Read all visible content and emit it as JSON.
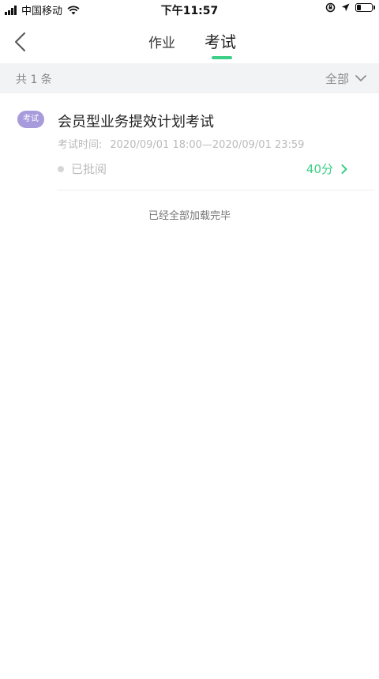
{
  "status_bar": {
    "carrier": "中国移动",
    "time": "下午11:57",
    "battery_level": 0.3
  },
  "nav": {
    "tabs": [
      {
        "label": "作业",
        "active": false
      },
      {
        "label": "考试",
        "active": true
      }
    ],
    "accent_color": "#3ccf86"
  },
  "filter": {
    "count_label": "共 1 条",
    "dropdown_label": "全部"
  },
  "exam_item": {
    "badge": "考试",
    "title": "会员型业务提效计划考试",
    "time_label": "考试时间:",
    "time_range": "2020/09/01 18:00—2020/09/01 23:59",
    "status": "已批阅",
    "score": "40分"
  },
  "end_note": "已经全部加载完毕"
}
